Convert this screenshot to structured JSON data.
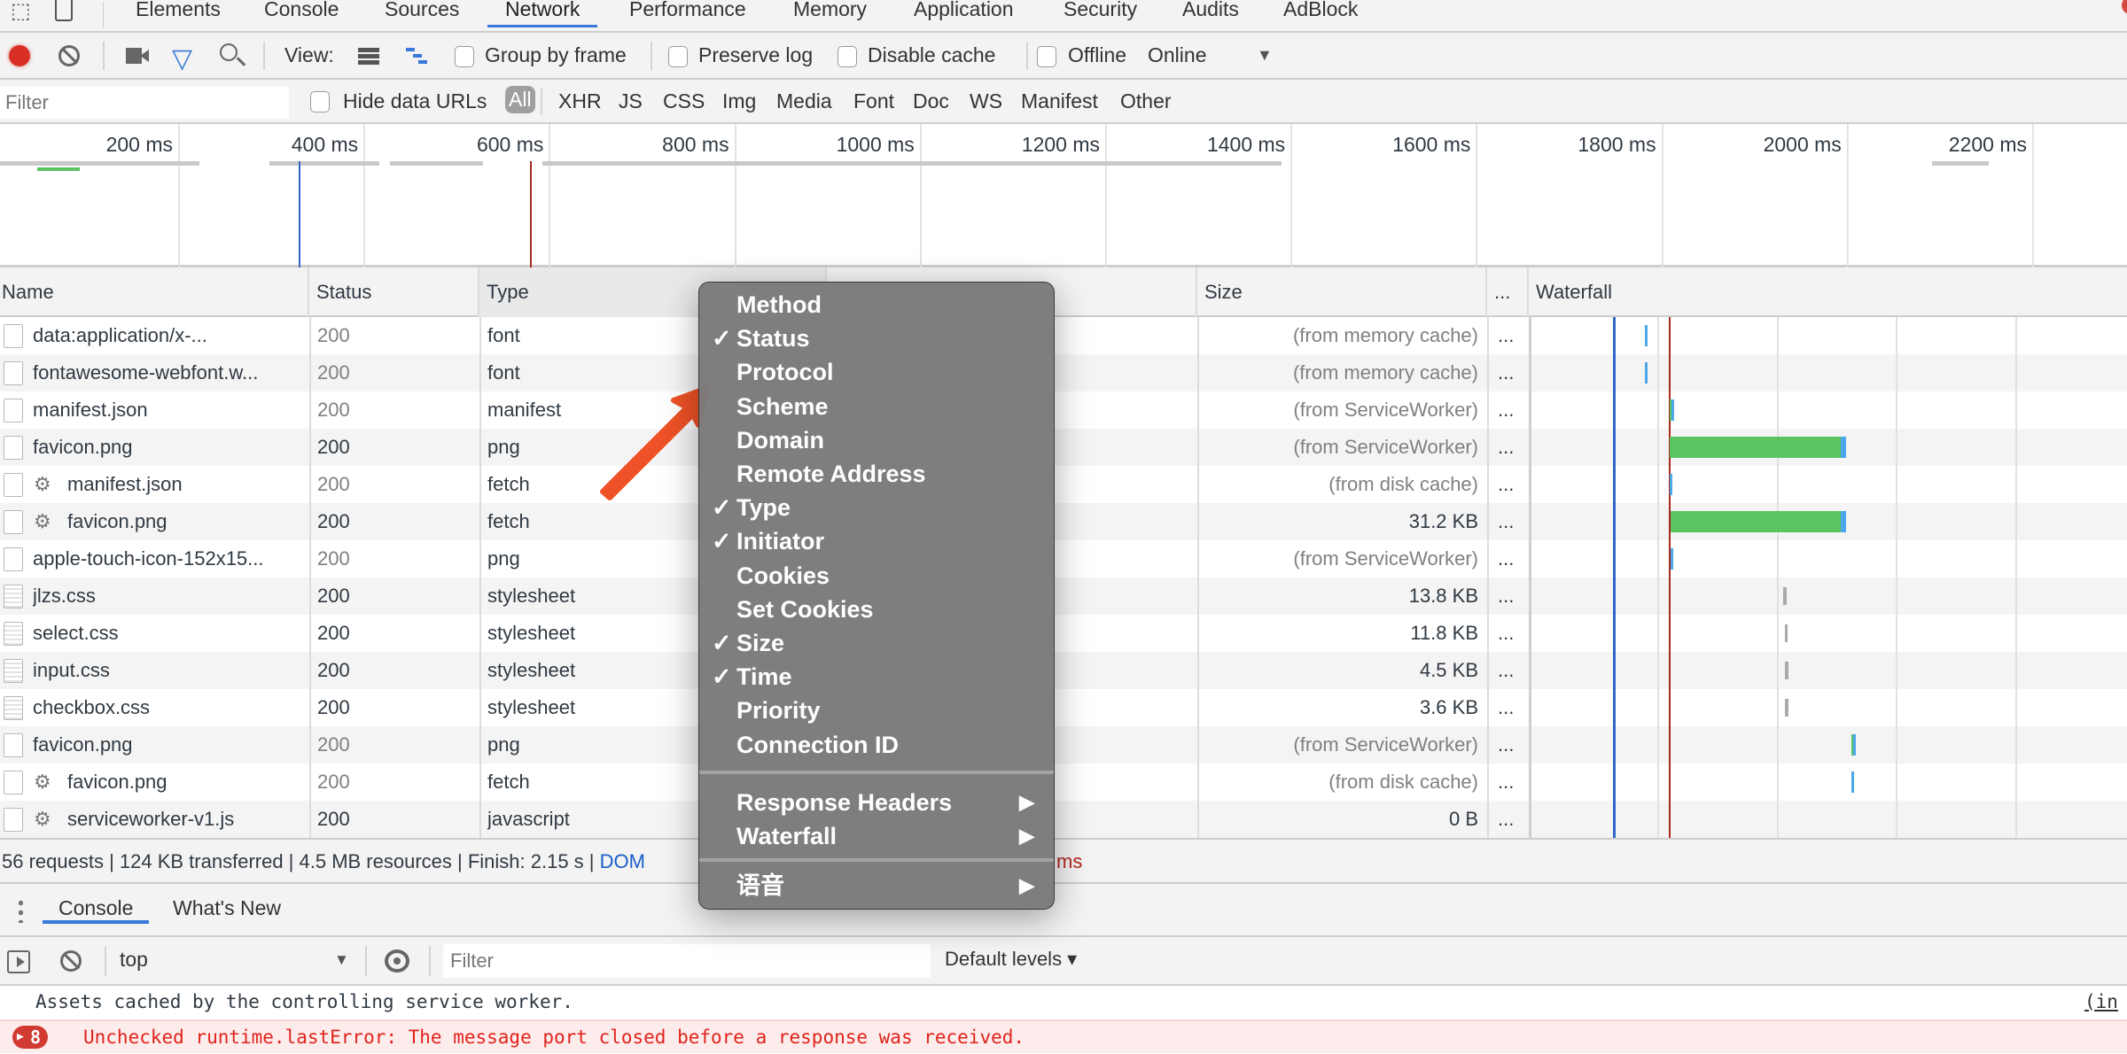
{
  "devtools_tabs": [
    "Elements",
    "Console",
    "Sources",
    "Network",
    "Performance",
    "Memory",
    "Application",
    "Security",
    "Audits",
    "AdBlock"
  ],
  "active_tab": "Network",
  "toolbar": {
    "view_label": "View:",
    "group_by_frame": {
      "label": "Group by frame",
      "checked": false
    },
    "preserve_log": {
      "label": "Preserve log",
      "checked": false
    },
    "disable_cache": {
      "label": "Disable cache",
      "checked": false
    },
    "offline": {
      "label": "Offline",
      "checked": false
    },
    "throttling": "Online"
  },
  "filterbar": {
    "filter_placeholder": "Filter",
    "hide_data_urls": {
      "label": "Hide data URLs",
      "checked": false
    },
    "types": [
      "All",
      "XHR",
      "JS",
      "CSS",
      "Img",
      "Media",
      "Font",
      "Doc",
      "WS",
      "Manifest",
      "Other"
    ],
    "active_type": "All"
  },
  "overview": {
    "ticks": [
      "200 ms",
      "400 ms",
      "600 ms",
      "800 ms",
      "1000 ms",
      "1200 ms",
      "1400 ms",
      "1600 ms",
      "1800 ms",
      "2000 ms",
      "2200 ms"
    ],
    "dom_content_loaded_ms": 330,
    "load_ms": 580
  },
  "table": {
    "columns": [
      "Name",
      "Status",
      "Type",
      "Size",
      "...",
      "Waterfall"
    ],
    "rows": [
      {
        "name": "data:application/x-...",
        "status": "200",
        "status_dim": true,
        "type": "font",
        "size": "(from memory cache)",
        "size_dim": true,
        "icon": "file",
        "sw": false,
        "wf": {
          "start": 0.19,
          "green": 0,
          "blue": 0.004
        }
      },
      {
        "name": "fontawesome-webfont.w...",
        "status": "200",
        "status_dim": true,
        "type": "font",
        "size": "(from memory cache)",
        "size_dim": true,
        "icon": "file",
        "sw": false,
        "wf": {
          "start": 0.19,
          "green": 0,
          "blue": 0.004
        }
      },
      {
        "name": "manifest.json",
        "status": "200",
        "status_dim": true,
        "type": "manifest",
        "size": "(from ServiceWorker)",
        "size_dim": true,
        "icon": "file",
        "sw": false,
        "wf": {
          "start": 0.232,
          "green": 0.002,
          "blue": 0.005
        }
      },
      {
        "name": "favicon.png",
        "status": "200",
        "status_dim": false,
        "type": "png",
        "size": "(from ServiceWorker)",
        "size_dim": true,
        "icon": "file",
        "sw": false,
        "wf": {
          "start": 0.232,
          "green": 0.288,
          "blue": 0.008
        }
      },
      {
        "name": "manifest.json",
        "status": "200",
        "status_dim": true,
        "type": "fetch",
        "size": "(from disk cache)",
        "size_dim": true,
        "icon": "file",
        "sw": true,
        "wf": {
          "start": 0.232,
          "green": 0,
          "blue": 0.004
        }
      },
      {
        "name": "favicon.png",
        "status": "200",
        "status_dim": false,
        "type": "fetch",
        "size": "31.2 KB",
        "size_dim": false,
        "icon": "file",
        "sw": true,
        "wf": {
          "start": 0.234,
          "green": 0.286,
          "blue": 0.008
        }
      },
      {
        "name": "apple-touch-icon-152x15...",
        "status": "200",
        "status_dim": true,
        "type": "png",
        "size": "(from ServiceWorker)",
        "size_dim": true,
        "icon": "file",
        "sw": false,
        "wf": {
          "start": 0.234,
          "green": 0,
          "blue": 0.004
        }
      },
      {
        "name": "jlzs.css",
        "status": "200",
        "status_dim": false,
        "type": "stylesheet",
        "size": "13.8 KB",
        "size_dim": false,
        "icon": "css",
        "sw": false,
        "wf": {
          "start": 0.422,
          "grey": 0.006
        }
      },
      {
        "name": "select.css",
        "status": "200",
        "status_dim": false,
        "type": "stylesheet",
        "size": "11.8 KB",
        "size_dim": false,
        "icon": "css",
        "sw": false,
        "wf": {
          "start": 0.425,
          "grey": 0.004
        }
      },
      {
        "name": "input.css",
        "status": "200",
        "status_dim": false,
        "type": "stylesheet",
        "size": "4.5 KB",
        "size_dim": false,
        "icon": "css",
        "sw": false,
        "wf": {
          "start": 0.425,
          "grey": 0.006
        }
      },
      {
        "name": "checkbox.css",
        "status": "200",
        "status_dim": false,
        "type": "stylesheet",
        "size": "3.6 KB",
        "size_dim": false,
        "icon": "css",
        "sw": false,
        "wf": {
          "start": 0.425,
          "grey": 0.006
        }
      },
      {
        "name": "favicon.png",
        "status": "200",
        "status_dim": true,
        "type": "png",
        "size": "(from ServiceWorker)",
        "size_dim": true,
        "icon": "file",
        "sw": false,
        "wf": {
          "start": 0.537,
          "green": 0.001,
          "blue": 0.003
        }
      },
      {
        "name": "favicon.png",
        "status": "200",
        "status_dim": true,
        "type": "fetch",
        "size": "(from disk cache)",
        "size_dim": true,
        "icon": "file",
        "sw": true,
        "wf": {
          "start": 0.537,
          "green": 0,
          "blue": 0.004
        }
      },
      {
        "name": "serviceworker-v1.js",
        "status": "200",
        "status_dim": false,
        "type": "javascript",
        "size": "0 B",
        "size_dim": false,
        "icon": "file",
        "sw": true,
        "wf": null
      }
    ]
  },
  "summary": {
    "text": "56 requests | 124 KB transferred | 4.5 MB resources | Finish: 2.15 s | ",
    "dom_label": "DOM",
    "load_tail": "ms"
  },
  "drawer": {
    "tabs": [
      "Console",
      "What's New"
    ],
    "active_tab": "Console",
    "context": "top",
    "filter_placeholder": "Filter",
    "levels": "Default levels ▾"
  },
  "console": {
    "messages": [
      {
        "text": "Assets cached by the controlling service worker.",
        "source": "(in",
        "level": "info"
      },
      {
        "text": "Unchecked runtime.lastError: The message port closed before a response was received.",
        "count": "8",
        "level": "error"
      }
    ]
  },
  "context_menu": {
    "items": [
      {
        "label": "Method",
        "checked": false
      },
      {
        "label": "Status",
        "checked": true
      },
      {
        "label": "Protocol",
        "checked": false
      },
      {
        "label": "Scheme",
        "checked": false
      },
      {
        "label": "Domain",
        "checked": false
      },
      {
        "label": "Remote Address",
        "checked": false
      },
      {
        "label": "Type",
        "checked": true
      },
      {
        "label": "Initiator",
        "checked": true
      },
      {
        "label": "Cookies",
        "checked": false
      },
      {
        "label": "Set Cookies",
        "checked": false
      },
      {
        "label": "Size",
        "checked": true
      },
      {
        "label": "Time",
        "checked": true
      },
      {
        "label": "Priority",
        "checked": false
      },
      {
        "label": "Connection ID",
        "checked": false
      }
    ],
    "submenus": [
      "Response Headers",
      "Waterfall"
    ],
    "language_submenu": "语音",
    "check_glyph": "✓",
    "submenu_glyph": "▶"
  },
  "colors": {
    "accent": "#3879d9",
    "record": "#d93025",
    "dcl_line": "#3465c7",
    "load_line": "#a52a1f",
    "wf_green": "#5cc361",
    "wf_blue": "#4ca8ea",
    "wf_grey": "#aaaaaa",
    "annotation_arrow": "#ee5226",
    "menu_bg": "#7a7a7a",
    "error_text": "#e0231b"
  }
}
